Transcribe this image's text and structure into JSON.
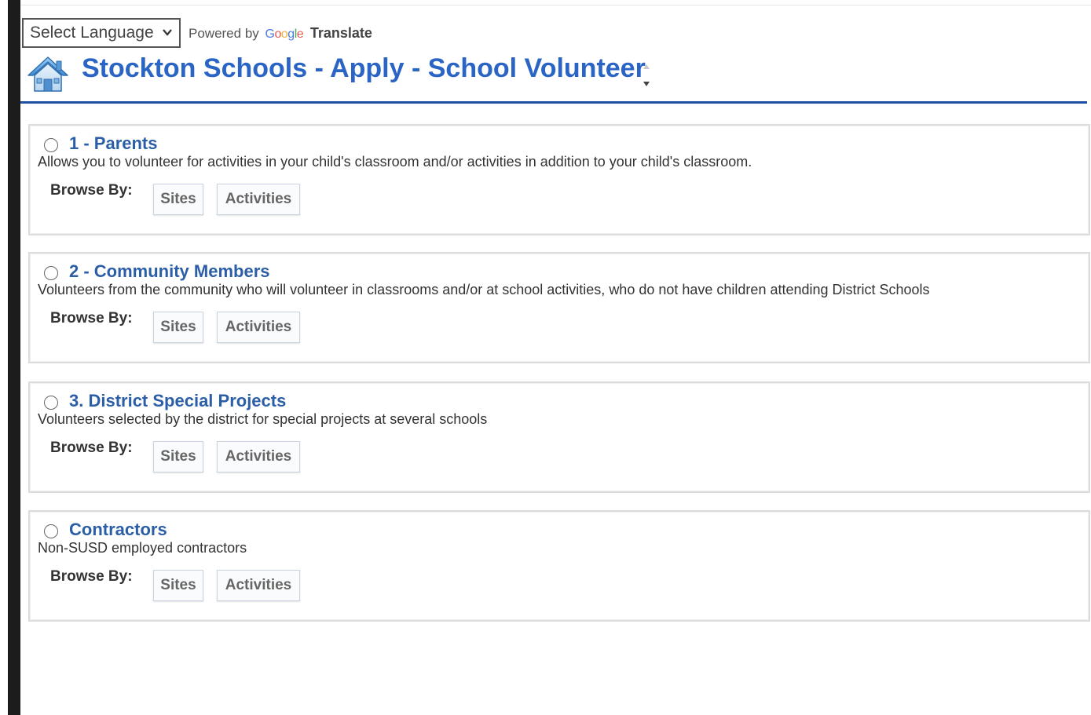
{
  "translate": {
    "select_label": "Select Language",
    "powered_by": "Powered by",
    "google": "Google",
    "translate": "Translate"
  },
  "header": {
    "title": "Stockton Schools - Apply - School Volunteer"
  },
  "options": [
    {
      "title": "1 - Parents",
      "description": "Allows you to volunteer for activities in your child's classroom and/or activities in addition to your child's classroom.",
      "browse_label": "Browse By:",
      "sites_label": "Sites",
      "activities_label": "Activities"
    },
    {
      "title": "2 - Community Members",
      "description": "Volunteers from the community who will volunteer in classrooms and/or at school activities, who do not have children attending District Schools",
      "browse_label": "Browse By:",
      "sites_label": "Sites",
      "activities_label": "Activities"
    },
    {
      "title": "3. District Special Projects",
      "description": "Volunteers selected by the district for special projects at several schools",
      "browse_label": "Browse By:",
      "sites_label": "Sites",
      "activities_label": "Activities"
    },
    {
      "title": "Contractors",
      "description": "Non-SUSD employed contractors",
      "browse_label": "Browse By:",
      "sites_label": "Sites",
      "activities_label": "Activities"
    }
  ],
  "colors": {
    "title_blue": "#2a64c5",
    "option_title_blue": "#2b5ea7",
    "header_rule": "#1e4fa3"
  },
  "icons": {
    "home": "home-icon",
    "dropdown": "chevron-down-icon",
    "scroll": "scroll-arrows-icon"
  }
}
